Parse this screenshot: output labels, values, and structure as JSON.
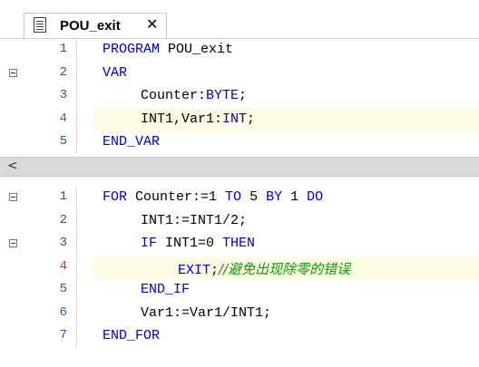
{
  "tab": {
    "label": "POU_exit",
    "close": "✕"
  },
  "declarations": [
    {
      "num": "1",
      "fold": false,
      "highlight": false,
      "indent": 0,
      "tokens": [
        [
          "kw",
          "PROGRAM"
        ],
        [
          "t",
          " POU_exit"
        ]
      ]
    },
    {
      "num": "2",
      "fold": true,
      "highlight": false,
      "indent": 0,
      "tokens": [
        [
          "kw",
          "VAR"
        ]
      ]
    },
    {
      "num": "3",
      "fold": false,
      "highlight": false,
      "indent": 1,
      "tokens": [
        [
          "t",
          "Counter:"
        ],
        [
          "kw",
          "BYTE"
        ],
        [
          "t",
          ";"
        ]
      ]
    },
    {
      "num": "4",
      "fold": false,
      "highlight": true,
      "indent": 1,
      "tokens": [
        [
          "t",
          "INT1,Var1:"
        ],
        [
          "kw",
          "INT"
        ],
        [
          "t",
          ";"
        ]
      ]
    },
    {
      "num": "5",
      "fold": false,
      "highlight": false,
      "indent": 0,
      "tokens": [
        [
          "kw",
          "END_VAR"
        ]
      ]
    }
  ],
  "splitter": {
    "arrow": "<"
  },
  "implementation": [
    {
      "num": "1",
      "fold": true,
      "highlight": false,
      "indent": 0,
      "tokens": [
        [
          "kw",
          "FOR"
        ],
        [
          "t",
          " Counter:=1 "
        ],
        [
          "kw",
          "TO"
        ],
        [
          "t",
          " 5 "
        ],
        [
          "kw",
          "BY"
        ],
        [
          "t",
          " 1 "
        ],
        [
          "kw",
          "DO"
        ]
      ]
    },
    {
      "num": "2",
      "fold": false,
      "highlight": false,
      "indent": 1,
      "tokens": [
        [
          "t",
          "INT1:=INT1/2;"
        ]
      ]
    },
    {
      "num": "3",
      "fold": true,
      "highlight": false,
      "indent": 1,
      "tokens": [
        [
          "kw",
          "IF"
        ],
        [
          "t",
          " INT1=0 "
        ],
        [
          "kw",
          "THEN"
        ]
      ]
    },
    {
      "num": "4",
      "fold": false,
      "highlight": true,
      "indent": 2,
      "tokens": [
        [
          "kw",
          "EXIT"
        ],
        [
          "t",
          ";"
        ],
        [
          "cmt",
          "//避免出现除零的错误"
        ]
      ]
    },
    {
      "num": "5",
      "fold": false,
      "highlight": false,
      "indent": 1,
      "tokens": [
        [
          "kw",
          "END_IF"
        ]
      ]
    },
    {
      "num": "6",
      "fold": false,
      "highlight": false,
      "indent": 1,
      "tokens": [
        [
          "t",
          "Var1:=Var1/INT1;"
        ]
      ]
    },
    {
      "num": "7",
      "fold": false,
      "highlight": false,
      "indent": 0,
      "tokens": [
        [
          "kw",
          "END_FOR"
        ]
      ]
    }
  ],
  "colors": {
    "keyword": "#0000cc",
    "comment": "#0a9a0a",
    "highlight": "#fdfbe3",
    "line_number": "#2b5797",
    "current_line_number": "#c0392b"
  }
}
